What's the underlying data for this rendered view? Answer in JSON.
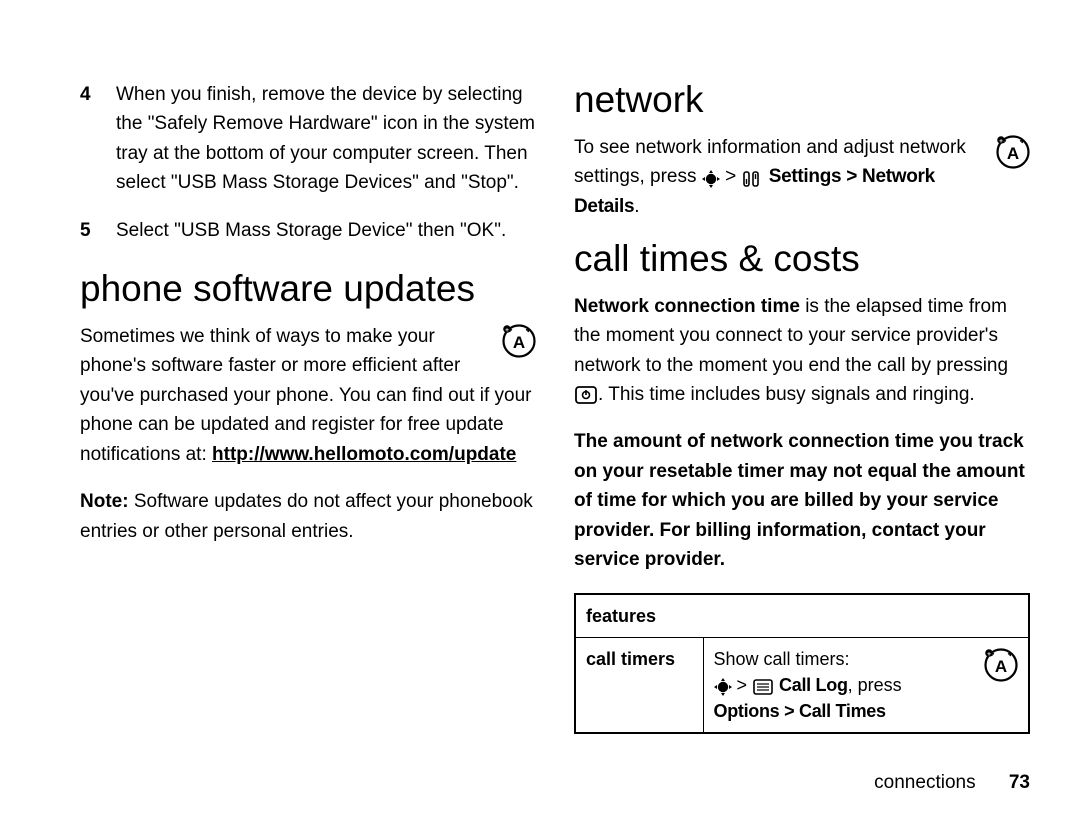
{
  "left": {
    "step4_num": "4",
    "step4_text": "When you finish, remove the device by selecting the \"Safely Remove Hardware\" icon in the system tray at the bottom of your computer screen. Then select \"USB Mass Storage Devices\" and \"Stop\".",
    "step5_num": "5",
    "step5_text": "Select \"USB Mass Storage Device\" then \"OK\".",
    "h_updates": "phone software updates",
    "updates_p1a": "Sometimes we think of ways to make your phone's software faster or more efficient after you've purchased your phone. You can find out if your phone can be updated and register for free update notifications at: ",
    "updates_url": "http://www.hellomoto.com/update",
    "updates_note_label": "Note:",
    "updates_note_text": " Software updates do not affect your phonebook entries or other personal entries."
  },
  "right": {
    "h_network": "network",
    "net_p_a": "To see network information and adjust network settings, press ",
    "net_p_b": " > ",
    "net_p_c": " Settings > Network Details",
    "net_p_d": ".",
    "h_calls": "call times & costs",
    "calls_p1_bold": "Network connection time",
    "calls_p1_rest": " is the elapsed time from the moment you connect to your service provider's network to the moment you end the call by pressing ",
    "calls_p1_tail": ". This time includes busy signals and ringing.",
    "calls_p2": "The amount of network connection time you track on your resetable timer may not equal the amount of time for which you are billed by your service provider. For billing information, contact your service provider.",
    "tbl_header": "features",
    "tbl_row_label": "call timers",
    "tbl_show": "Show call timers:",
    "tbl_gt": " > ",
    "tbl_calllog": " Call Log",
    "tbl_press": ", press ",
    "tbl_options": "Options > Call Times"
  },
  "footer": {
    "section": "connections",
    "page": "73"
  }
}
